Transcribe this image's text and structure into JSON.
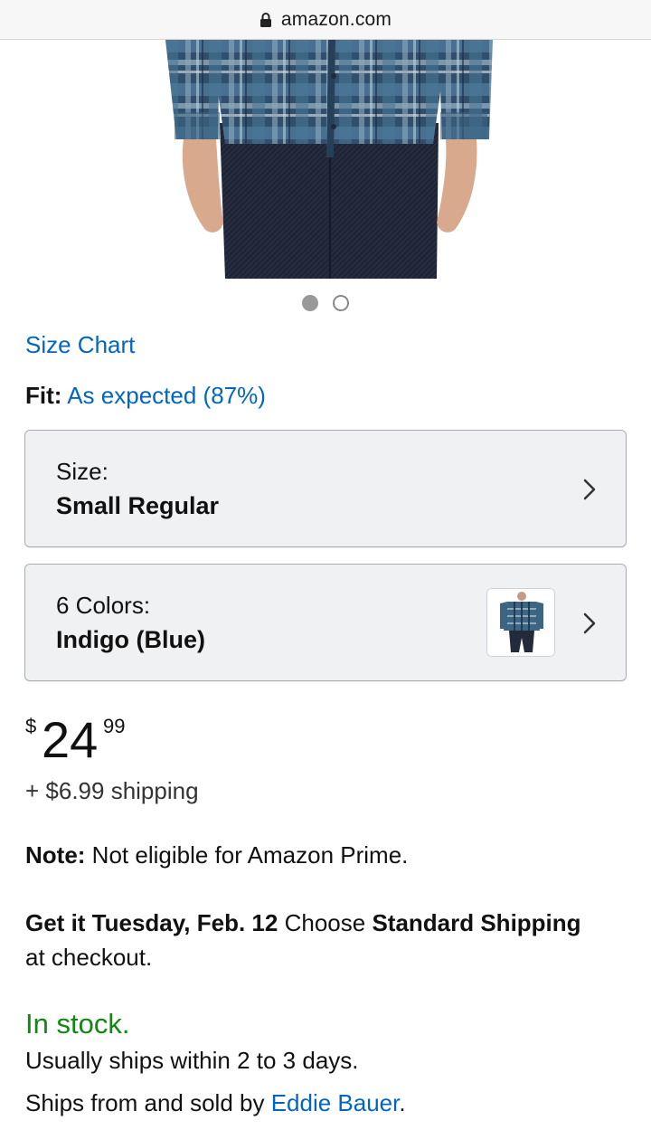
{
  "browser": {
    "url": "amazon.com",
    "lock_icon": "lock-icon"
  },
  "product": {
    "image_icon": "plaid-shirt-photo",
    "carousel": {
      "total": 2,
      "active_index": 0
    }
  },
  "links": {
    "size_chart": "Size Chart"
  },
  "fit": {
    "label": "Fit:",
    "value": "As expected (87%)"
  },
  "size_selector": {
    "label": "Size:",
    "value": "Small Regular"
  },
  "color_selector": {
    "label": "6 Colors:",
    "value": "Indigo (Blue)"
  },
  "price": {
    "symbol": "$",
    "whole": "24",
    "fraction": "99"
  },
  "shipping": "+ $6.99 shipping",
  "note": {
    "label": "Note:",
    "text": "Not eligible for Amazon Prime."
  },
  "delivery": {
    "bold_date": "Get it Tuesday, Feb. 12",
    "text_choose": "Choose",
    "bold_option": "Standard Shipping",
    "text_end": "at checkout."
  },
  "availability": {
    "status": "In stock.",
    "ships_within": "Usually ships within 2 to 3 days.",
    "sold_by_prefix": "Ships from and sold by",
    "seller": "Eddie Bauer",
    "sold_by_suffix": "."
  },
  "colors": {
    "link": "#0066c0",
    "in_stock": "#118811",
    "selector_bg": "#f0f1f3"
  }
}
